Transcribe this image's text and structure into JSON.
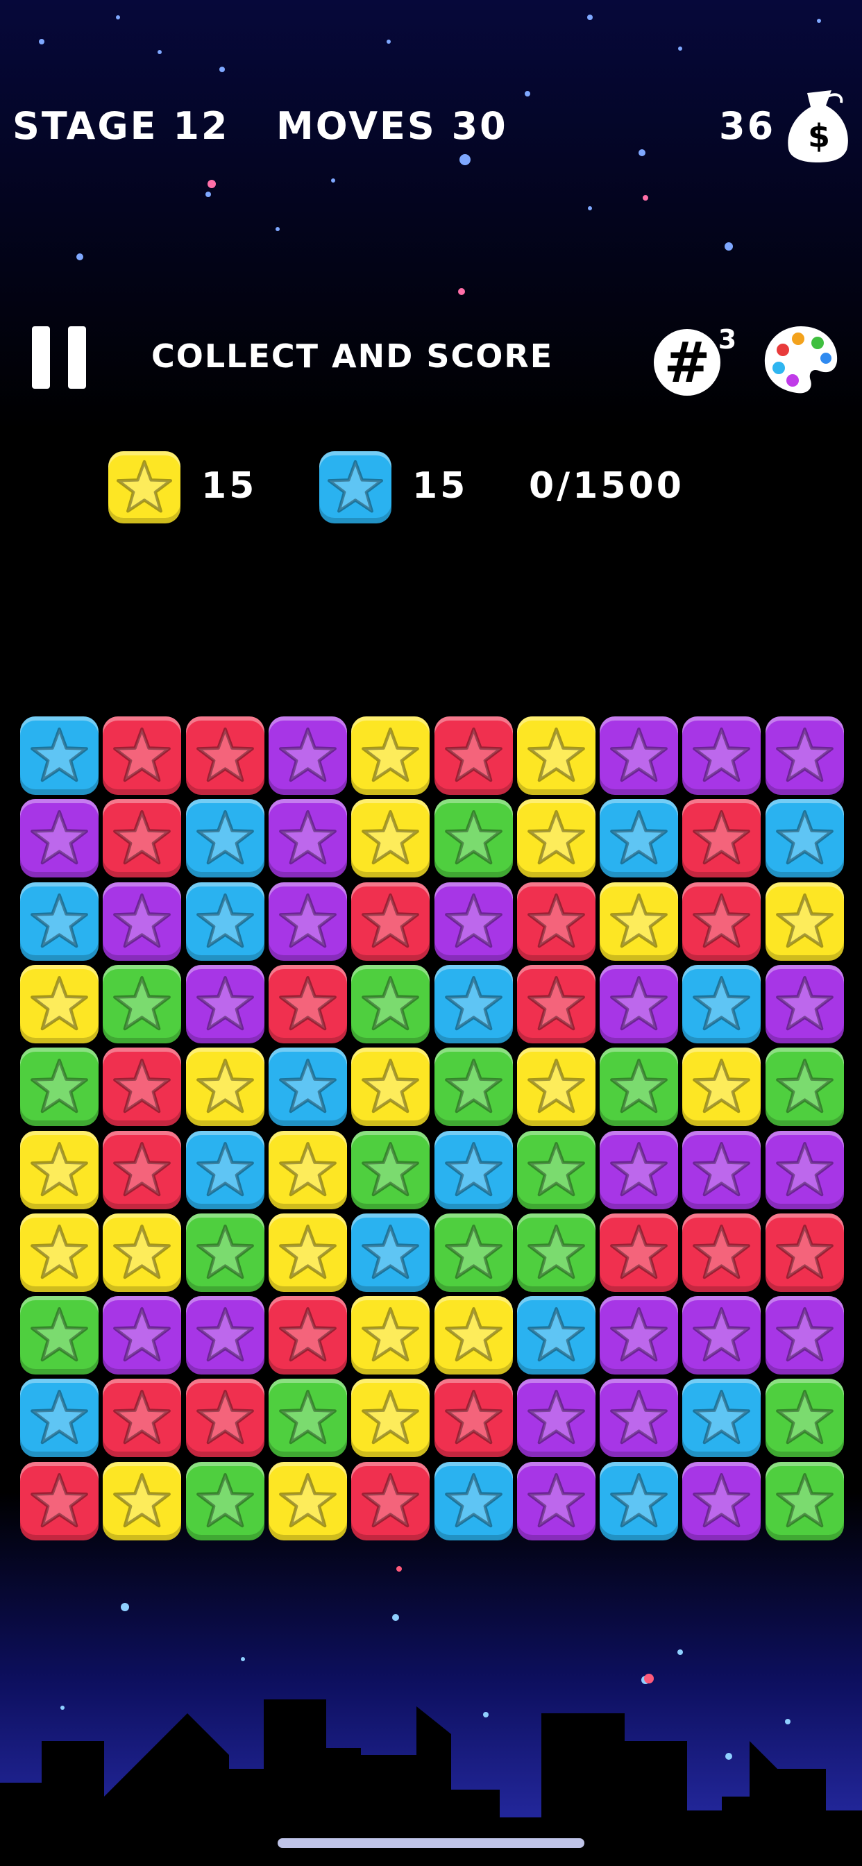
{
  "header": {
    "stage_label": "STAGE 12",
    "moves_label": "MOVES 30",
    "coins": "36"
  },
  "toolbar": {
    "objective_text": "COLLECT AND SCORE",
    "hash_badge": "3"
  },
  "goals": {
    "yellow_count": "15",
    "blue_count": "15",
    "score_progress": "0/1500"
  },
  "colors": {
    "red": "#f0304f",
    "purple": "#a736e6",
    "blue": "#2ab2f0",
    "yellow": "#fde624",
    "green": "#4fcf3f"
  },
  "board": [
    [
      "blue",
      "red",
      "red",
      "purple",
      "yellow",
      "red",
      "yellow",
      "purple",
      "purple",
      "purple"
    ],
    [
      "purple",
      "red",
      "blue",
      "purple",
      "yellow",
      "green",
      "yellow",
      "blue",
      "red",
      "blue"
    ],
    [
      "blue",
      "purple",
      "blue",
      "purple",
      "red",
      "purple",
      "red",
      "yellow",
      "red",
      "yellow"
    ],
    [
      "yellow",
      "green",
      "purple",
      "red",
      "green",
      "blue",
      "red",
      "purple",
      "blue",
      "purple"
    ],
    [
      "green",
      "red",
      "yellow",
      "blue",
      "yellow",
      "green",
      "yellow",
      "green",
      "yellow",
      "green"
    ],
    [
      "yellow",
      "red",
      "blue",
      "yellow",
      "green",
      "blue",
      "green",
      "purple",
      "purple",
      "purple"
    ],
    [
      "yellow",
      "yellow",
      "green",
      "yellow",
      "blue",
      "green",
      "green",
      "red",
      "red",
      "red"
    ],
    [
      "green",
      "purple",
      "purple",
      "red",
      "yellow",
      "yellow",
      "blue",
      "purple",
      "purple",
      "purple"
    ],
    [
      "blue",
      "red",
      "red",
      "green",
      "yellow",
      "red",
      "purple",
      "purple",
      "blue",
      "green"
    ],
    [
      "red",
      "yellow",
      "green",
      "yellow",
      "red",
      "blue",
      "purple",
      "blue",
      "purple",
      "green"
    ]
  ]
}
